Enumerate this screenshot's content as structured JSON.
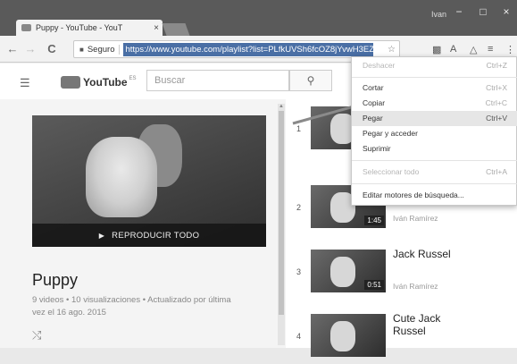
{
  "browser": {
    "tab_title": "Puppy - YouTube - YouT",
    "tab_close": "×",
    "user_name": "Ivan",
    "window_controls": {
      "minimize": "−",
      "maximize": "□",
      "close": "×"
    },
    "nav": {
      "back": "←",
      "forward": "→",
      "reload": "C"
    },
    "address": {
      "secure_label": "Seguro",
      "url": "https://www.youtube.com/playlist?list=PLfkUVSh6fcOZ8jYvwH3EZD"
    }
  },
  "youtube": {
    "logo": "YouTube",
    "logo_suffix": "ES",
    "search_placeholder": "Buscar"
  },
  "playlist": {
    "play_all": "REPRODUCIR TODO",
    "title": "Puppy",
    "meta": "9 videos • 10 visualizaciones • Actualizado por última vez el 16 ago. 2015"
  },
  "videos": [
    {
      "num": "1",
      "title": "",
      "channel": "",
      "duration": ""
    },
    {
      "num": "2",
      "title": "",
      "channel": "Iván Ramírez",
      "duration": "1:45"
    },
    {
      "num": "3",
      "title": "Jack Russel",
      "channel": "Iván Ramírez",
      "duration": "0:51"
    },
    {
      "num": "4",
      "title": "Cute Jack Russel",
      "channel": "",
      "duration": ""
    }
  ],
  "context_menu": {
    "undo": {
      "label": "Deshacer",
      "shortcut": "Ctrl+Z"
    },
    "cut": {
      "label": "Cortar",
      "shortcut": "Ctrl+X"
    },
    "copy": {
      "label": "Copiar",
      "shortcut": "Ctrl+C"
    },
    "paste": {
      "label": "Pegar",
      "shortcut": "Ctrl+V"
    },
    "paste_go": {
      "label": "Pegar y acceder"
    },
    "delete": {
      "label": "Suprimir"
    },
    "select_all": {
      "label": "Seleccionar todo",
      "shortcut": "Ctrl+A"
    },
    "edit_engines": {
      "label": "Editar motores de búsqueda..."
    }
  },
  "colors": {
    "url_highlight": "#4a6fa5",
    "titlebar": "#5a5a5a"
  }
}
